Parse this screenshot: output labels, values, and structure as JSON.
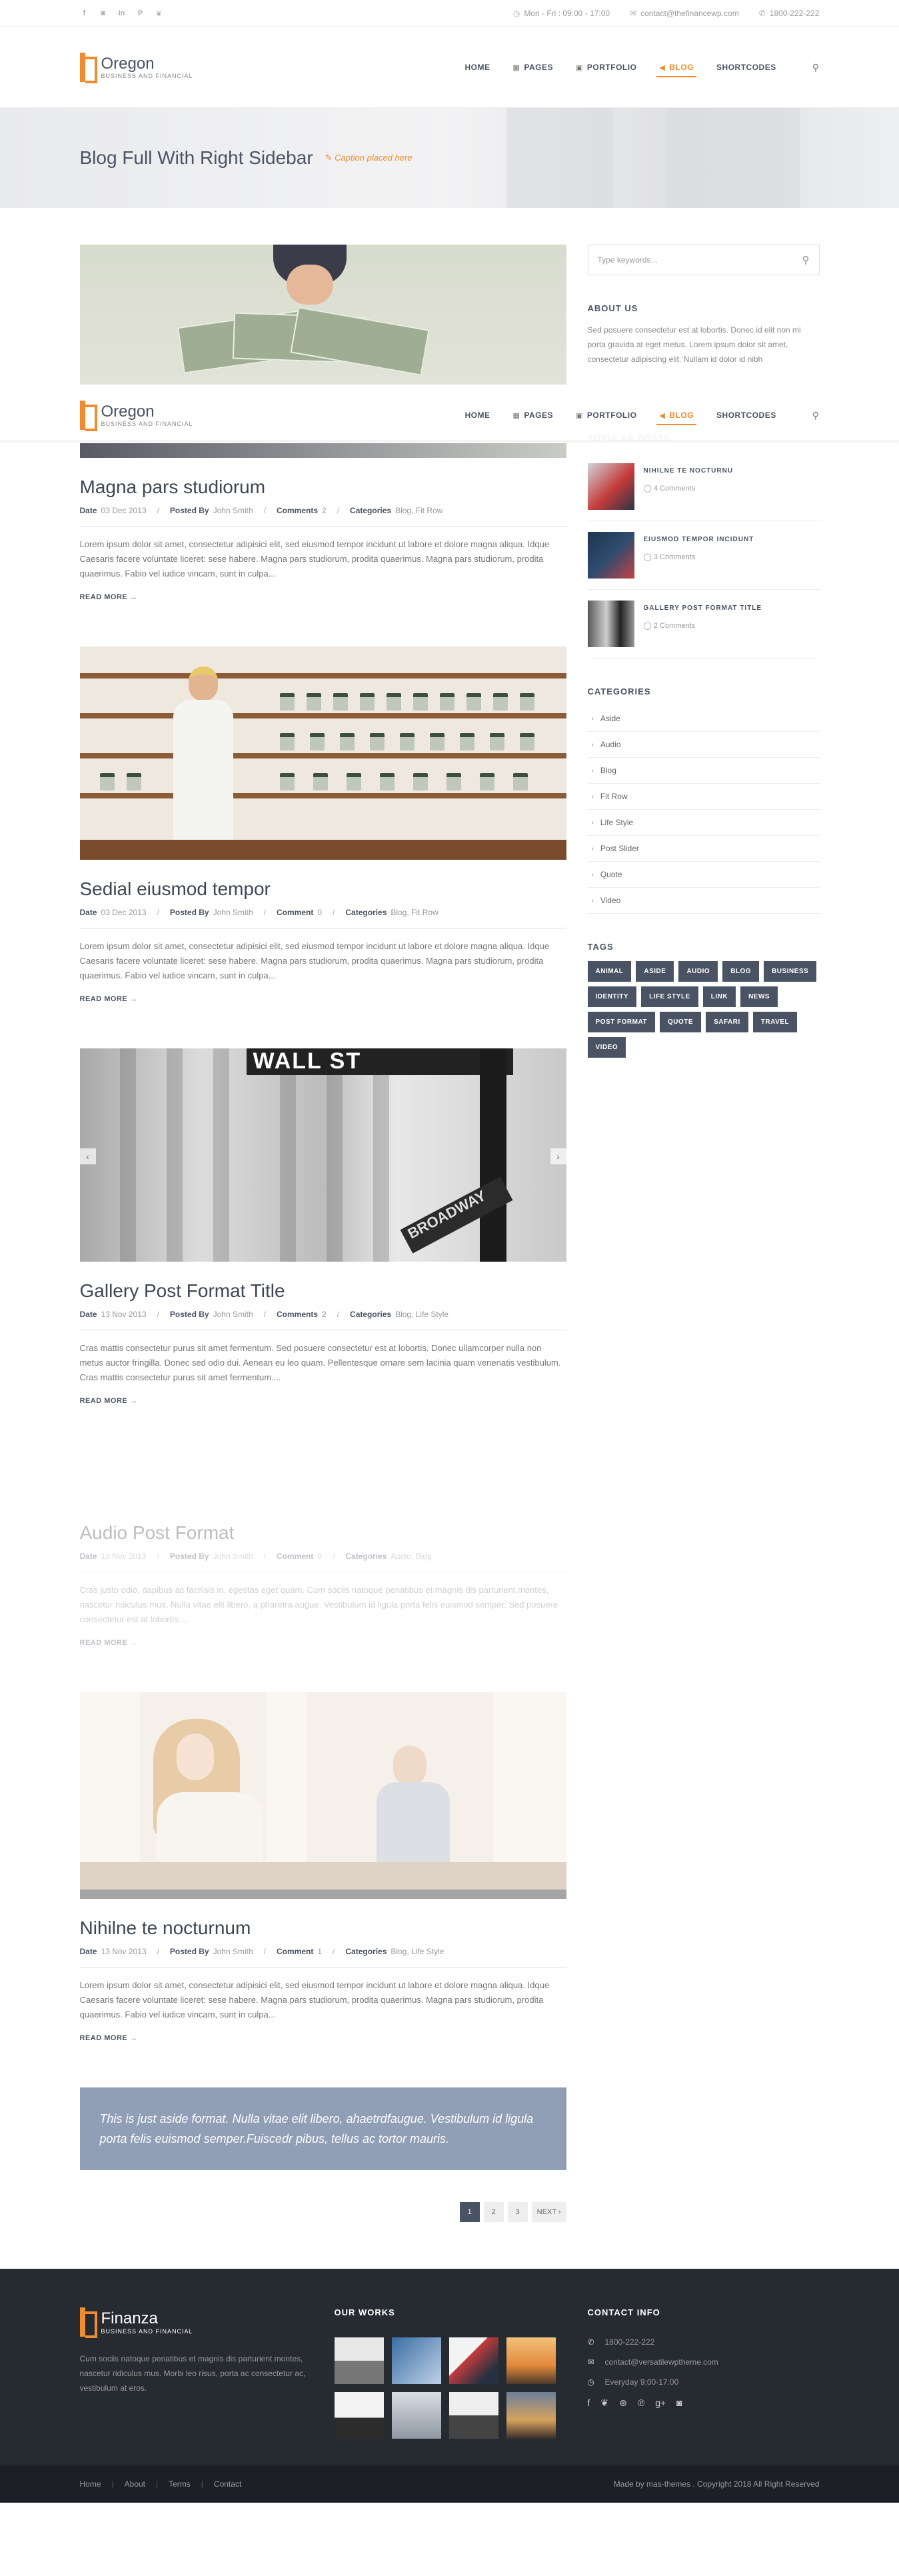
{
  "topbar": {
    "social": [
      "f",
      "in",
      "in",
      "P",
      "t"
    ],
    "social_icons": [
      "facebook-icon",
      "instagram-icon",
      "linkedin-icon",
      "pinterest-icon",
      "twitter-icon"
    ],
    "hours": "Mon - Fri : 09:00 - 17:00",
    "email": "contact@thefinancewp.com",
    "phone": "1800-222-222"
  },
  "brand": {
    "name": "Oregon",
    "tagline": "BUSINESS AND FINANCIAL",
    "accent": "#f08c2e",
    "dark": "#4a5364"
  },
  "nav": {
    "items": [
      {
        "label": "HOME",
        "icon": ""
      },
      {
        "label": "PAGES",
        "icon": "building-icon"
      },
      {
        "label": "PORTFOLIO",
        "icon": "briefcase-icon"
      },
      {
        "label": "BLOG",
        "icon": "megaphone-icon"
      },
      {
        "label": "SHORTCODES",
        "icon": ""
      }
    ],
    "active": "BLOG"
  },
  "banner": {
    "title": "Blog Full With Right Sidebar",
    "caption": "Caption placed here"
  },
  "meta_labels": {
    "date": "Date",
    "posted_by": "Posted By",
    "categories": "Categories",
    "read_more": "READ MORE →"
  },
  "posts": [
    {
      "title": "Magna pars studiorum",
      "date": "03 Dec 2013",
      "author": "John Smith",
      "comments_label": "Comments",
      "comments": "2",
      "categories": "Blog, Fit Row",
      "excerpt": "Lorem ipsum dolor sit amet, consectetur adipisici elit, sed eiusmod tempor incidunt ut labore et dolore magna aliqua. Idque Caesaris facere voluntate liceret: sese habere. Magna pars studiorum, prodita quaerimus. Magna pars studiorum, prodita quaerimus. Fabio vel iudice vincam, sunt in culpa..."
    },
    {
      "title": "Sedial eiusmod tempor",
      "date": "03 Dec 2013",
      "author": "John Smith",
      "comments_label": "Comment",
      "comments": "0",
      "categories": "Blog, Fit Row",
      "excerpt": "Lorem ipsum dolor sit amet, consectetur adipisici elit, sed eiusmod tempor incidunt ut labore et dolore magna aliqua. Idque Caesaris facere voluntate liceret: sese habere. Magna pars studiorum, prodita quaerimus. Magna pars studiorum, prodita quaerimus. Fabio vel iudice vincam, sunt in culpa..."
    },
    {
      "title": "Gallery Post Format Title",
      "date": "13 Nov 2013",
      "author": "John Smith",
      "comments_label": "Comments",
      "comments": "2",
      "categories": "Blog, Life Style",
      "excerpt": "Cras mattis consectetur purus sit amet fermentum. Sed posuere consectetur est at lobortis. Donec ullamcorper nulla non metus auctor fringilla. Donec sed odio dui. Aenean eu leo quam. Pellentesque ornare sem lacinia quam venenatis vestibulum. Cras mattis consectetur purus sit amet fermentum...."
    },
    {
      "title": "Audio Post Format",
      "date": "13 Nov 2013",
      "author": "John Smith",
      "comments_label": "Comment",
      "comments": "0",
      "categories": "Audio, Blog",
      "excerpt": "Cras justo odio, dapibus ac facilisis in, egestas eget quam. Cum sociis natoque penatibus et magnis dis parturient montes, nascetur ridiculus mus. Nulla vitae elit libero, a pharetra augue. Vestibulum id ligula porta felis euismod semper. Sed posuere consectetur est at lobortis...."
    },
    {
      "title": "Nihilne te nocturnum",
      "date": "13 Nov 2013",
      "author": "John Smith",
      "comments_label": "Comment",
      "comments": "1",
      "categories": "Blog, Life Style",
      "excerpt": "Lorem ipsum dolor sit amet, consectetur adipisici elit, sed eiusmod tempor incidunt ut labore et dolore magna aliqua. Idque Caesaris facere voluntate liceret: sese habere. Magna pars studiorum, prodita quaerimus. Magna pars studiorum, prodita quaerimus. Fabio vel iudice vincam, sunt in culpa..."
    }
  ],
  "quote": "This is just aside format. Nulla vitae elit libero, ahaetrdfaugue. Vestibulum id ligula porta felis euismod semper.Fuiscedr pibus, tellus ac tortor mauris.",
  "pagination": [
    "1",
    "2",
    "3",
    "NEXT ›"
  ],
  "sidebar": {
    "search_placeholder": "Type keywords...",
    "about_title": "ABOUT US",
    "about_text": "Sed posuere consectetur est at lobortis. Donec id elit non mi porta gravida at eget metus. Lorem ipsum dolor sit amet, consectetur adipiscing elit. Nullam id dolor id nibh",
    "popular_title": "POPULAR POSTS",
    "popular": [
      {
        "title": "NIHILNE TE NOCTURNU",
        "comments": "4 Comments"
      },
      {
        "title": "EIUSMOD TEMPOR INCIDUNT",
        "comments": "3 Comments"
      },
      {
        "title": "GALLERY POST FORMAT TITLE",
        "comments": "2 Comments"
      }
    ],
    "categories_title": "CATEGORIES",
    "categories": [
      "Aside",
      "Audio",
      "Blog",
      "Fit Row",
      "Life Style",
      "Post Slider",
      "Quote",
      "Video"
    ],
    "tags_title": "TAGS",
    "tags": [
      "ANIMAL",
      "ASIDE",
      "AUDIO",
      "BLOG",
      "BUSINESS",
      "IDENTITY",
      "LIFE STYLE",
      "LINK",
      "NEWS",
      "POST FORMAT",
      "QUOTE",
      "SAFARI",
      "TRAVEL",
      "VIDEO"
    ]
  },
  "footer": {
    "brand": "Finanza",
    "tagline": "BUSINESS AND FINANCIAL",
    "about": "Cum sociis natoque penatibus et magnis dis parturient montes, nascetur ridiculus mus. Morbi leo risus, porta ac consectetur ac, vestibulum at eros.",
    "works_title": "OUR WORKS",
    "contact_title": "CONTACT INFO",
    "phone": "1800-222-222",
    "email": "contact@versatilewptheme.com",
    "hours": "Everyday 9:00-17:00",
    "social_icons": [
      "facebook-icon",
      "twitter-icon",
      "dribbble-icon",
      "pinterest-icon",
      "google-plus-icon",
      "instagram-icon"
    ],
    "links": [
      "Home",
      "About",
      "Terms",
      "Contact"
    ],
    "copyright": "Made by mas-themes . Copyright 2018 All Right Reserved"
  }
}
